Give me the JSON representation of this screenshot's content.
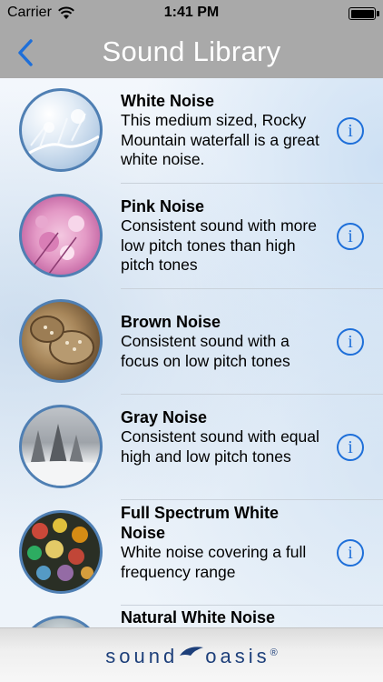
{
  "status": {
    "carrier": "Carrier",
    "time": "1:41 PM"
  },
  "nav": {
    "title": "Sound Library"
  },
  "items": [
    {
      "title": "White Noise",
      "description": "This medium sized, Rocky Mountain waterfall is a great white noise."
    },
    {
      "title": "Pink Noise",
      "description": "Consistent sound with more low pitch tones than high pitch tones"
    },
    {
      "title": "Brown Noise",
      "description": "Consistent sound with a focus on low pitch tones"
    },
    {
      "title": "Gray Noise",
      "description": "Consistent sound with equal high and low pitch tones"
    },
    {
      "title": "Full Spectrum White Noise",
      "description": "White noise covering a full frequency range"
    },
    {
      "title": "Natural White Noise",
      "description": ""
    }
  ],
  "info_glyph": "i",
  "footer": {
    "logo_left": "sound",
    "logo_right": "oasis",
    "logo_mark": "®"
  },
  "colors": {
    "accent": "#1e6fd9",
    "nav_background": "#a9a9a9",
    "brand": "#1d3f7a"
  }
}
